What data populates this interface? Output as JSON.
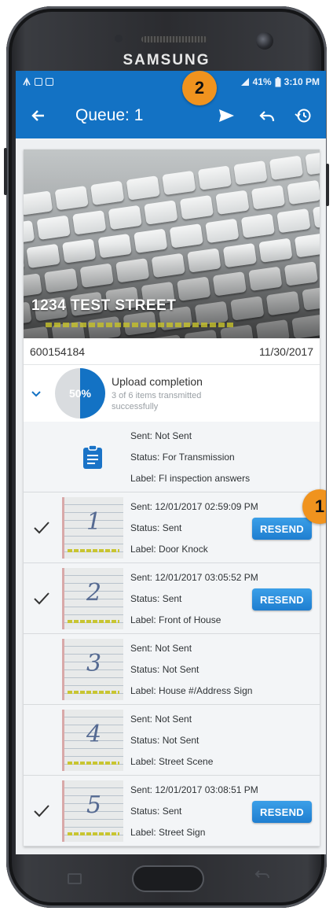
{
  "device": {
    "brand": "SAMSUNG"
  },
  "status_bar": {
    "battery": "41%",
    "time": "3:10 PM"
  },
  "app_bar": {
    "title": "Queue: 1",
    "back_icon": "arrow-left-icon",
    "send_icon": "send-icon",
    "undo_icon": "undo-icon",
    "history_icon": "history-icon",
    "color": "#1372c4"
  },
  "property": {
    "address": "1234 TEST STREET",
    "id": "600154184",
    "date": "11/30/2017"
  },
  "upload": {
    "title": "Upload completion",
    "subtitle": "3 of 6 items transmitted successfully",
    "percent_label": "50%",
    "progress": 0.5
  },
  "queue_items": [
    {
      "sent": "Sent: Not Sent",
      "status": "Status: For Transmission",
      "label": "Label: FI inspection answers",
      "checked": false,
      "thumb": "clipboard-icon",
      "resend": false
    },
    {
      "sent": "Sent: 12/01/2017 02:59:09 PM",
      "status": "Status: Sent",
      "label": "Label: Door Knock",
      "checked": true,
      "thumb": "1",
      "resend": true
    },
    {
      "sent": "Sent: 12/01/2017 03:05:52 PM",
      "status": "Status: Sent",
      "label": "Label: Front of House",
      "checked": true,
      "thumb": "2",
      "resend": true
    },
    {
      "sent": "Sent: Not Sent",
      "status": "Status: Not Sent",
      "label": "Label: House #/Address Sign",
      "checked": false,
      "thumb": "3",
      "resend": false
    },
    {
      "sent": "Sent: Not Sent",
      "status": "Status: Not Sent",
      "label": "Label: Street Scene",
      "checked": false,
      "thumb": "4",
      "resend": false
    },
    {
      "sent": "Sent: 12/01/2017 03:08:51 PM",
      "status": "Status: Sent",
      "label": "Label: Street Sign",
      "checked": true,
      "thumb": "5",
      "resend": true
    }
  ],
  "resend_label": "RESEND",
  "callouts": {
    "first": "1",
    "second": "2",
    "color": "#f0931e"
  }
}
